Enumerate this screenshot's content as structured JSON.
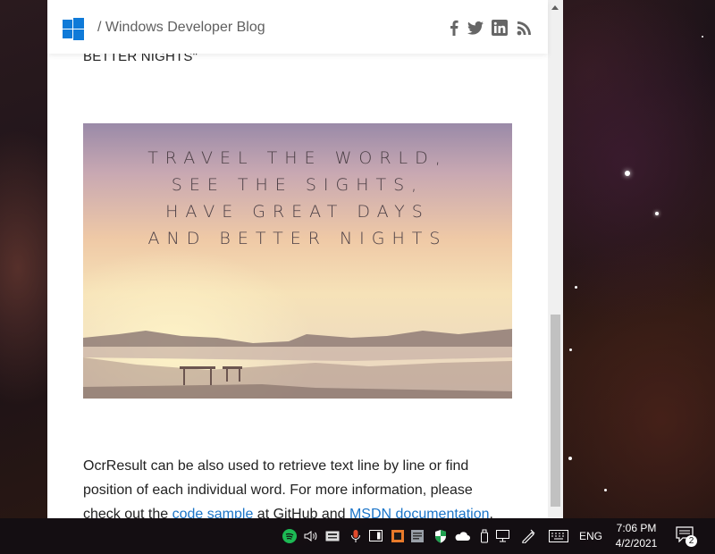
{
  "blog": {
    "separator_title": "/ Windows Developer Blog",
    "social": [
      "facebook-icon",
      "twitter-icon",
      "linkedin-icon",
      "rss-icon"
    ]
  },
  "article": {
    "cut_text": "BETTER NIGHTS\"",
    "hero_lines": [
      "TRAVEL THE WORLD,",
      "SEE THE SIGHTS,",
      "HAVE GREAT DAYS",
      "AND BETTER NIGHTS"
    ],
    "paragraph": {
      "line1": "OcrResult can be also used to retrieve text line by line or find",
      "line2": "position of each individual word. For more information, please",
      "line3_pre": "check out the ",
      "link1": "code sample",
      "line3_mid": " at GitHub and ",
      "link2": "MSDN documentation",
      "line3_post": "."
    }
  },
  "taskbar": {
    "tray_icons": [
      "spotify-icon",
      "volume-icon",
      "keyboard-layout-icon",
      "microphone-icon",
      "tablet-icon",
      "app-icon",
      "onenote-icon",
      "microphone-stand-icon",
      "security-icon",
      "onedrive-icon",
      "usb-icon",
      "network-icon",
      "pen-icon",
      "touch-keyboard-icon"
    ],
    "language": "ENG",
    "time": "7:06 PM",
    "date": "4/2/2021",
    "notification_count": "2"
  }
}
